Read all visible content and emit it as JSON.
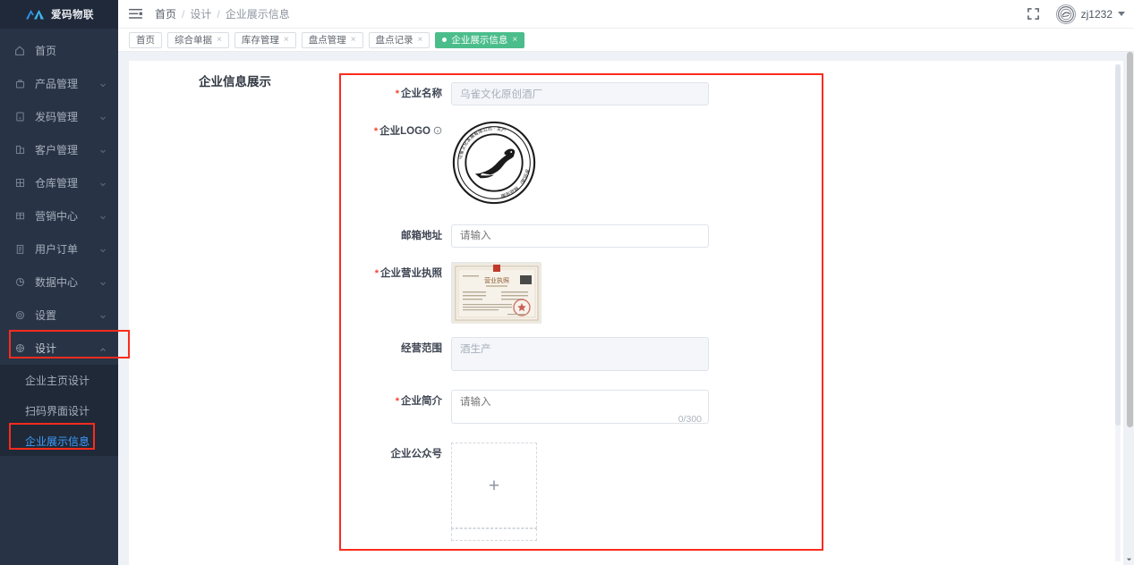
{
  "brand": {
    "name": "爱码物联",
    "mark_icon": "mountain-logo-icon"
  },
  "sidebar": {
    "items": [
      {
        "label": "首页",
        "icon": "home-icon",
        "expandable": false
      },
      {
        "label": "产品管理",
        "icon": "bag-icon",
        "expandable": true
      },
      {
        "label": "发码管理",
        "icon": "code-card-icon",
        "expandable": true
      },
      {
        "label": "客户管理",
        "icon": "building-icon",
        "expandable": true
      },
      {
        "label": "仓库管理",
        "icon": "grid-icon",
        "expandable": true
      },
      {
        "label": "营销中心",
        "icon": "table-icon",
        "expandable": true
      },
      {
        "label": "用户订单",
        "icon": "clipboard-icon",
        "expandable": true
      },
      {
        "label": "数据中心",
        "icon": "pie-chart-icon",
        "expandable": true
      },
      {
        "label": "设置",
        "icon": "gear-icon",
        "expandable": true
      },
      {
        "label": "设计",
        "icon": "compass-icon",
        "expandable": true,
        "expanded": true
      }
    ],
    "submenu": [
      {
        "label": "企业主页设计",
        "active": false
      },
      {
        "label": "扫码界面设计",
        "active": false
      },
      {
        "label": "企业展示信息",
        "active": true
      }
    ],
    "active_color": "#3f9dfd",
    "background": "#283446",
    "submenu_background": "#1f2938"
  },
  "topbar": {
    "menu_toggle_icon": "hamburger-icon",
    "fullscreen_icon": "fullscreen-expand-icon",
    "breadcrumb": [
      "首页",
      "设计",
      "企业展示信息"
    ],
    "breadcrumb_separator": "/",
    "user": {
      "name": "zj1232",
      "avatar_icon": "company-seal-avatar",
      "caret_icon": "chevron-down-icon"
    }
  },
  "tabbar": {
    "tabs": [
      {
        "label": "首页",
        "closable": false,
        "active": false
      },
      {
        "label": "综合单据",
        "closable": true,
        "active": false
      },
      {
        "label": "库存管理",
        "closable": true,
        "active": false
      },
      {
        "label": "盘点管理",
        "closable": true,
        "active": false
      },
      {
        "label": "盘点记录",
        "closable": true,
        "active": false
      },
      {
        "label": "企业展示信息",
        "closable": true,
        "active": true
      }
    ],
    "active_color": "#4bbd8b",
    "close_glyph": "×"
  },
  "page": {
    "title": "企业信息展示"
  },
  "form": {
    "rows": [
      {
        "label": "企业名称",
        "required": true,
        "type": "input",
        "value": "乌雀文化原创酒厂",
        "placeholder": "请输入",
        "disabled": true
      },
      {
        "label": "企业LOGO",
        "required": true,
        "type": "image",
        "has_info_icon": true,
        "info_icon": "info-circle-icon",
        "image_name": "company-seal-logo"
      },
      {
        "label": "邮箱地址",
        "required": false,
        "type": "input",
        "value": "",
        "placeholder": "请输入",
        "disabled": false
      },
      {
        "label": "企业营业执照",
        "required": true,
        "type": "image",
        "image_name": "business-license-photo"
      },
      {
        "label": "经营范围",
        "required": false,
        "type": "textarea",
        "value": "酒生产",
        "placeholder": "请输入",
        "disabled": true
      },
      {
        "label": "企业简介",
        "required": true,
        "type": "textarea",
        "value": "",
        "placeholder": "请输入",
        "counter": "0/300",
        "disabled": false
      },
      {
        "label": "企业公众号",
        "required": false,
        "type": "uploader",
        "upload_glyph": "+"
      }
    ],
    "required_marker": "*",
    "annotation_color": "#fb2c1d"
  },
  "annotations": {
    "color": "#fb2c1d",
    "boxes": [
      "sidebar-design-menu",
      "sidebar-company-display-info",
      "main-form-panel"
    ]
  }
}
